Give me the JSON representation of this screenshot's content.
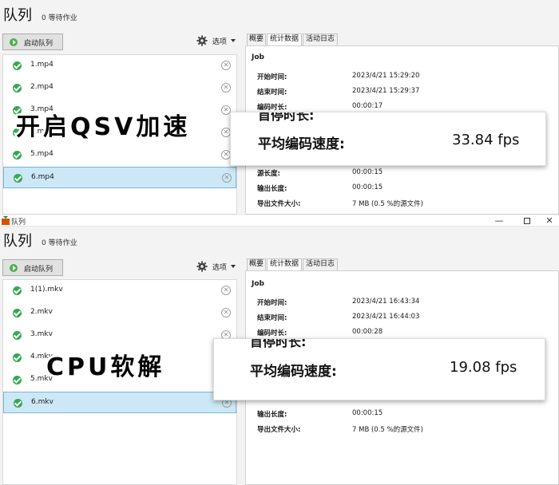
{
  "top": {
    "title": "队列",
    "pending": "0 等待作业",
    "start_button": "启动队列",
    "options": "选项",
    "tabs": [
      "概要",
      "统计数据",
      "活动日志"
    ],
    "items": [
      "1.mp4",
      "2.mp4",
      "3.mp4",
      "4.mp4",
      "5.mp4",
      "6.mp4"
    ],
    "selected_index": 5,
    "job": "Job",
    "stats": [
      {
        "label": "开始时间:",
        "value": "2023/4/21 15:29:20"
      },
      {
        "label": "结束时间:",
        "value": "2023/4/21 15:29:37"
      },
      {
        "label": "编码时长:",
        "value": "00:00:17"
      },
      {
        "label": "源长度:",
        "value": "00:00:15"
      },
      {
        "label": "输出长度:",
        "value": "00:00:15"
      },
      {
        "label": "导出文件大小:",
        "value": "7 MB (0.5 %的源文件)"
      }
    ],
    "overlay": "开启QSV加速",
    "callout_partial": "首停时长:",
    "speed_label": "平均编码速度:",
    "speed_value": "33.84 fps"
  },
  "bottom": {
    "window_title": "队列",
    "title": "队列",
    "pending": "0 等待作业",
    "start_button": "启动队列",
    "options": "选项",
    "tabs": [
      "概要",
      "统计数据",
      "活动日志"
    ],
    "items": [
      "1(1).mkv",
      "2.mkv",
      "3.mkv",
      "4.mkv",
      "5.mkv",
      "6.mkv"
    ],
    "selected_index": 5,
    "job": "Job",
    "stats": [
      {
        "label": "开始时间:",
        "value": "2023/4/21 16:43:34"
      },
      {
        "label": "结束时间:",
        "value": "2023/4/21 16:44:03"
      },
      {
        "label": "编码时长:",
        "value": "00:00:28"
      },
      {
        "label": "输出长度:",
        "value": "00:00:15"
      },
      {
        "label": "导出文件大小:",
        "value": "7 MB (0.5 %的源文件)"
      }
    ],
    "overlay": "CPU软解",
    "callout_partial": "首停时长:",
    "speed_label": "平均编码速度:",
    "speed_value": "19.08 fps"
  },
  "colors": {
    "selected_bg": "#cce8f7",
    "check_green": "#34a853",
    "play_green": "#4caf50"
  },
  "icons": {
    "check": "check-circle-icon",
    "remove": "close-circle-icon",
    "options": "gear-icon",
    "start": "play-icon",
    "app": "app-icon"
  }
}
